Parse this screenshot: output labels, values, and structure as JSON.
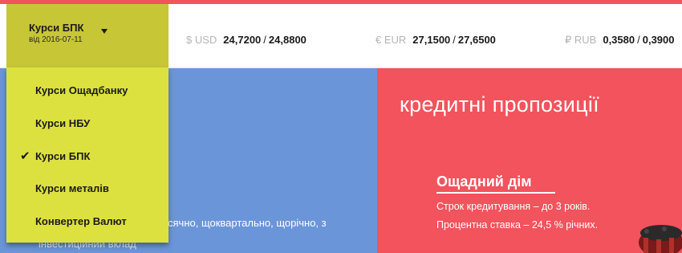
{
  "header": {
    "selector": {
      "label": "Курси БПК",
      "date": "від 2016-07-11"
    },
    "rates": [
      {
        "currency": "$ USD",
        "buy": "24,7200",
        "sell": "24,8800"
      },
      {
        "currency": "€ EUR",
        "buy": "27,1500",
        "sell": "27,6500"
      },
      {
        "currency": "₽ RUB",
        "buy": "0,3580",
        "sell": "0,3900"
      }
    ],
    "rate_separator": "/"
  },
  "dropdown": {
    "items": [
      {
        "label": "Курси Ощадбанку",
        "selected": false
      },
      {
        "label": "Курси НБУ",
        "selected": false
      },
      {
        "label": "Курси БПК",
        "selected": true
      },
      {
        "label": "Курси металів",
        "selected": false
      },
      {
        "label": "Конвертер Валют",
        "selected": false
      }
    ],
    "check_glyph": "✔"
  },
  "blue_panel": {
    "text_line": "сячно, щоквартально, щорічно, з",
    "text_line2": "інвестиційний вклад"
  },
  "red_panel": {
    "title": "кредитні пропозиції",
    "offer": {
      "title": "Ощадний дім",
      "term": "Строк кредитування – до 3 років.",
      "rate": "Процентна ставка – 24,5 % річних."
    }
  },
  "colors": {
    "accent_red": "#f2535c",
    "blue_panel": "#6b95d9",
    "selector_olive": "#c7c637",
    "dropdown_yellow": "#dde13f"
  }
}
